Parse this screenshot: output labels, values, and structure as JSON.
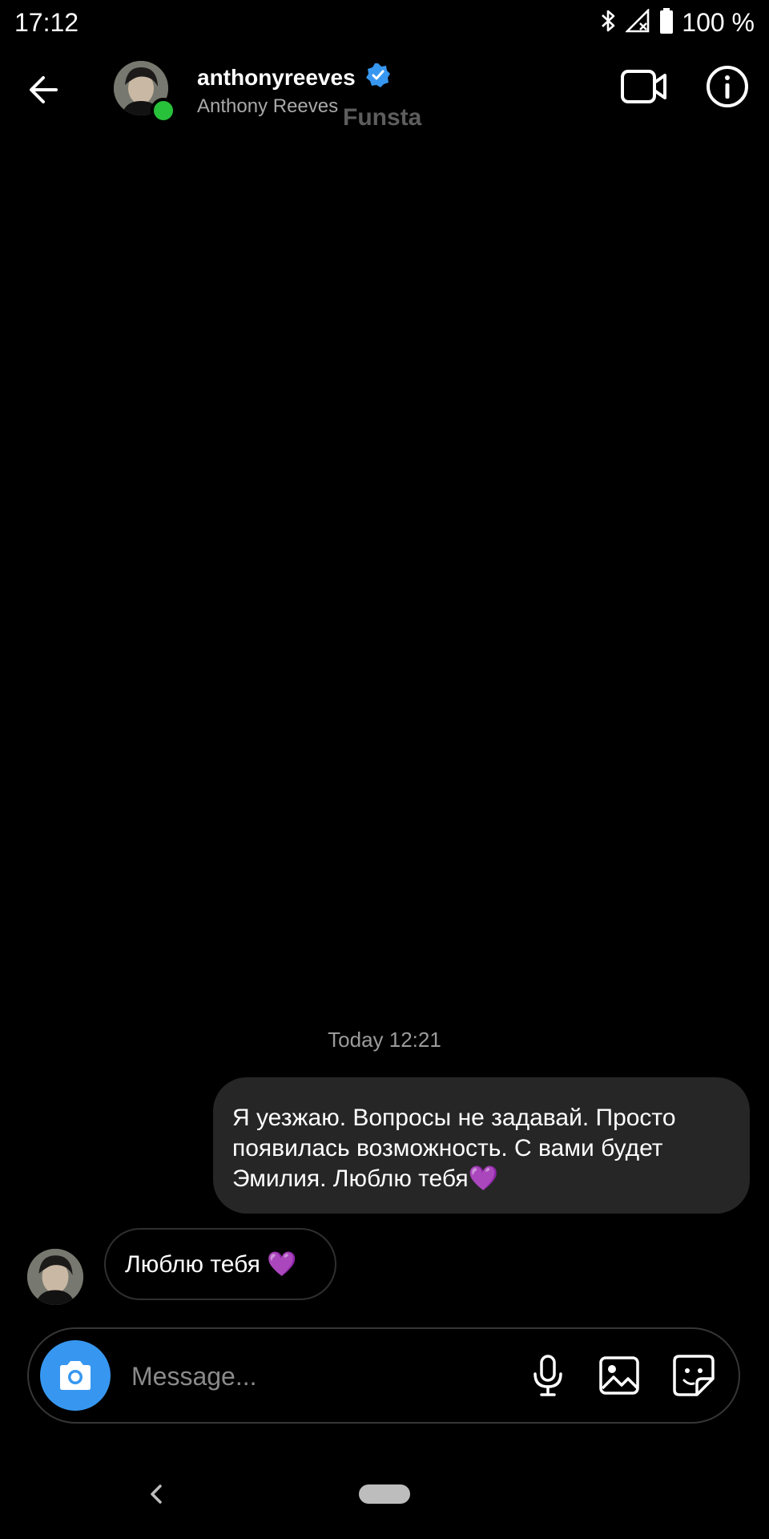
{
  "status_bar": {
    "time": "17:12",
    "battery": "100 %",
    "icons": [
      "bluetooth-icon",
      "signal-icon",
      "battery-icon"
    ]
  },
  "header": {
    "username": "anthonyreeves",
    "full_name": "Anthony Reeves",
    "overlay_label": "Funsta",
    "verified": true,
    "online": true,
    "icons": [
      "back-arrow-icon",
      "video-call-icon",
      "info-icon"
    ]
  },
  "conversation": {
    "timestamp": "Today 12:21",
    "messages": [
      {
        "direction": "outgoing",
        "text": "Я уезжаю. Вопросы не задавай. Просто появилась возможность. С вами будет Эмилия. Люблю тебя💜"
      },
      {
        "direction": "incoming",
        "text": "Люблю тебя 💜"
      }
    ]
  },
  "composer": {
    "placeholder": "Message...",
    "icons": [
      "camera-icon",
      "microphone-icon",
      "gallery-icon",
      "sticker-icon"
    ]
  },
  "colors": {
    "background": "#000000",
    "accent": "#3797f0",
    "online": "#28c13a",
    "verified": "#3797f0",
    "bubble_out": "#262626"
  }
}
